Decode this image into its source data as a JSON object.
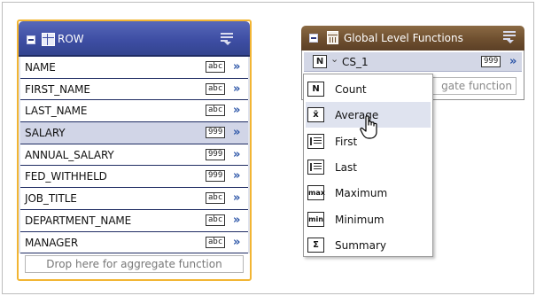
{
  "row_panel": {
    "title": "ROW",
    "fields": [
      {
        "name": "NAME",
        "type": "abc",
        "selected": false
      },
      {
        "name": "FIRST_NAME",
        "type": "abc",
        "selected": false
      },
      {
        "name": "LAST_NAME",
        "type": "abc",
        "selected": false
      },
      {
        "name": "SALARY",
        "type": "999",
        "selected": true
      },
      {
        "name": "ANNUAL_SALARY",
        "type": "999",
        "selected": false
      },
      {
        "name": "FED_WITHHELD",
        "type": "999",
        "selected": false
      },
      {
        "name": "JOB_TITLE",
        "type": "abc",
        "selected": false
      },
      {
        "name": "DEPARTMENT_NAME",
        "type": "abc",
        "selected": false
      },
      {
        "name": "MANAGER",
        "type": "abc",
        "selected": false
      }
    ],
    "arrow_glyph": "»",
    "drop_hint": "Drop here for aggregate function"
  },
  "glf_panel": {
    "title": "Global Level Functions",
    "item": {
      "badge": "N",
      "caret": "⌄",
      "name": "CS_1",
      "type": "999",
      "arrow_glyph": "»"
    },
    "drop_hint_partial": "gate function"
  },
  "function_menu": {
    "items": [
      {
        "icon": "N",
        "label": "Count"
      },
      {
        "icon": "x̄",
        "label": "Average"
      },
      {
        "icon": "",
        "label": "First"
      },
      {
        "icon": "",
        "label": "Last"
      },
      {
        "icon": "max",
        "label": "Maximum"
      },
      {
        "icon": "min",
        "label": "Minimum"
      },
      {
        "icon": "Σ",
        "label": "Summary"
      }
    ],
    "hovered": "Average"
  },
  "colors": {
    "row_header": "#3e4ea4",
    "row_border": "#f2b533",
    "glf_header": "#6e4f2f",
    "selected_row": "#d1d5e7",
    "arrow": "#2d56a8"
  },
  "icons": {
    "collapse": "minus-box-icon",
    "table": "table-icon",
    "calendar": "calendar-icon",
    "menu": "menu-lines-icon",
    "cursor": "hand-pointer-icon"
  }
}
